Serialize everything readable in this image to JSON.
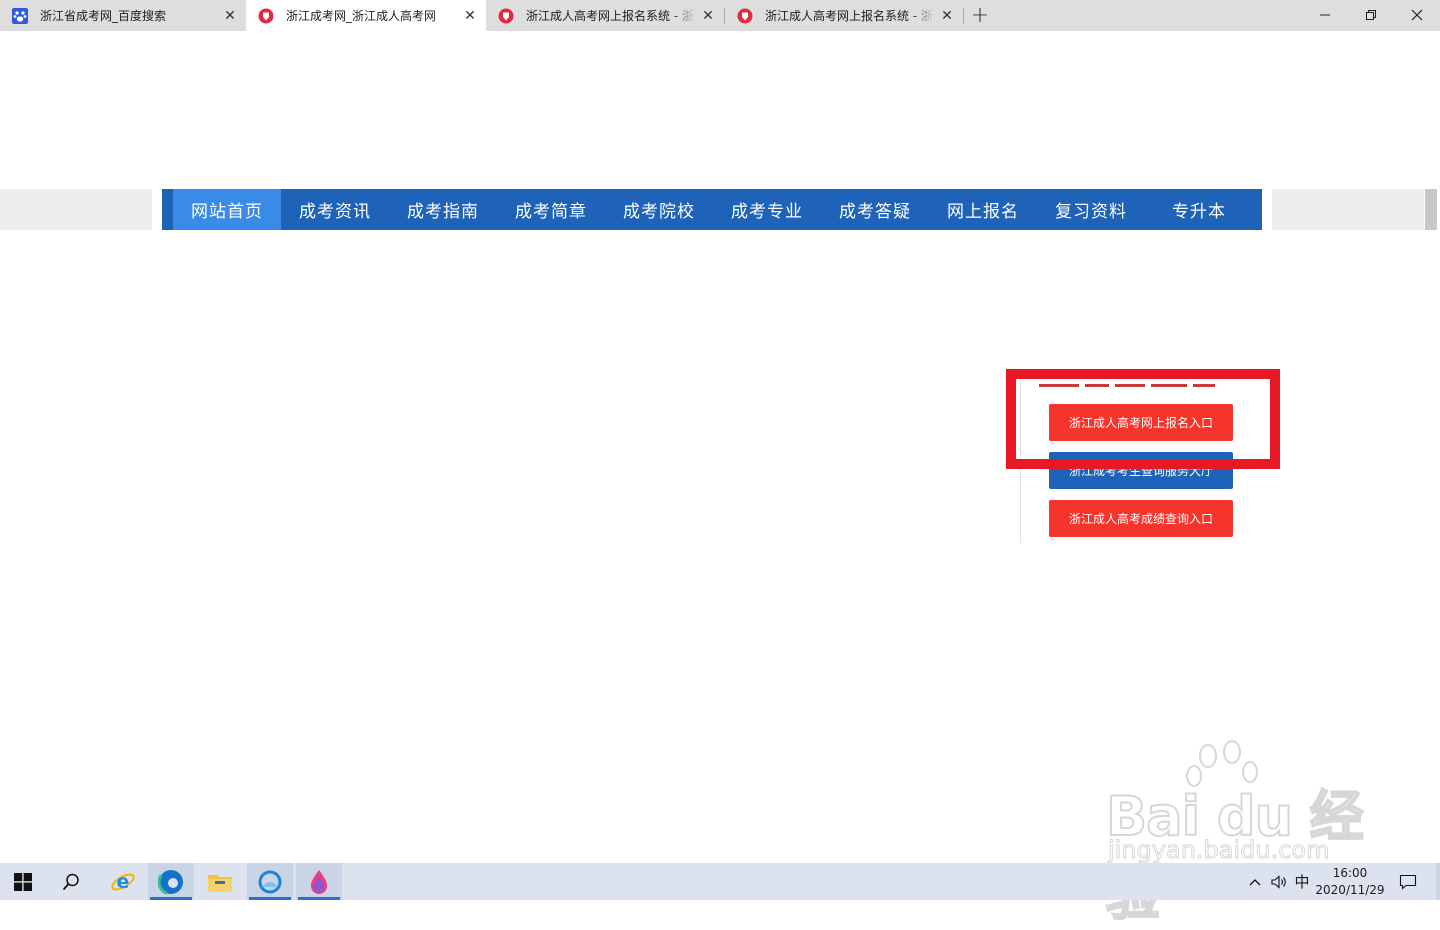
{
  "browser": {
    "tabs": [
      {
        "title": "浙江省成考网_百度搜索",
        "favicon": "baidu-paw-icon",
        "active": false
      },
      {
        "title": "浙江成考网_浙江成人高考网",
        "favicon": "site-shield-icon",
        "active": true
      },
      {
        "title": "浙江成人高考网上报名系统 - 浙江",
        "favicon": "site-shield-icon",
        "active": false
      },
      {
        "title": "浙江成人高考网上报名系统 - 浙江",
        "favicon": "site-shield-icon",
        "active": false
      }
    ],
    "new_tab_glyph": "+",
    "window_controls": {
      "minimize": "—",
      "restore": "❐",
      "close": "✕"
    }
  },
  "nav": {
    "items": [
      "网站首页",
      "成考资讯",
      "成考指南",
      "成考简章",
      "成考院校",
      "成考专业",
      "成考答疑",
      "网上报名",
      "复习资料",
      "专升本"
    ],
    "current_index": 0
  },
  "entry_panel": {
    "buttons": [
      {
        "label": "浙江成人高考网上报名入口",
        "color": "#f5352b"
      },
      {
        "label": "浙江成考考生查询服务大厅",
        "color": "#1f63b8"
      },
      {
        "label": "浙江成人高考成绩查询入口",
        "color": "#f5352b"
      }
    ]
  },
  "colors": {
    "nav_bg": "#1f63b8",
    "nav_current": "#3a8ae8",
    "highlight_border": "#e81925"
  },
  "watermark": {
    "brand": "Bai du 经验",
    "url": "jingyan.baidu.com"
  },
  "taskbar": {
    "apps": [
      "windows-start-icon",
      "search-icon",
      "ie-icon",
      "edge-icon",
      "file-explorer-icon",
      "photos-icon",
      "paint-drop-icon"
    ],
    "ime": "中",
    "time": "16:00",
    "date": "2020/11/29"
  }
}
